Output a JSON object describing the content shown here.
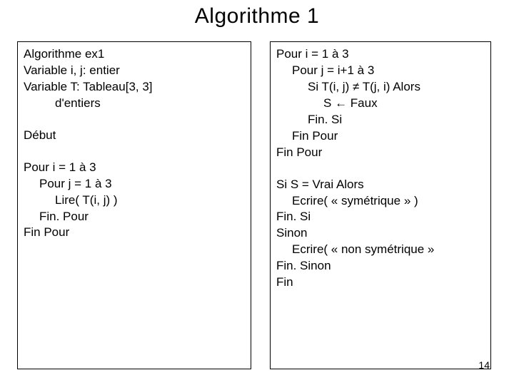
{
  "title": "Algorithme 1",
  "left": {
    "l1": "Algorithme ex1",
    "l2": "Variable i, j: entier",
    "l3": "Variable T: Tableau[3, 3]",
    "l4": "d'entiers",
    "l5": "Début",
    "l6": "Pour i = 1 à 3",
    "l7": "Pour j = 1 à 3",
    "l8": "Lire( T(i, j) )",
    "l9": "Fin. Pour",
    "l10": "Fin Pour"
  },
  "right": {
    "r1": "Pour i = 1 à 3",
    "r2": "Pour j = i+1 à 3",
    "r3_a": "Si T(i, j) ",
    "r3_b": " T(j, i) Alors",
    "neq": "≠",
    "r4_a": "S ",
    "r4_b": " Faux",
    "arrow": "←",
    "r5": "Fin. Si",
    "r6": "Fin Pour",
    "r7": "Fin Pour",
    "r8": "Si S = Vrai Alors",
    "r9": "Ecrire( « symétrique » )",
    "r10": "Fin. Si",
    "r11": "Sinon",
    "r12": "Ecrire( « non symétrique »",
    "r13": "Fin. Sinon",
    "r14": "Fin"
  },
  "pagenum": "14"
}
